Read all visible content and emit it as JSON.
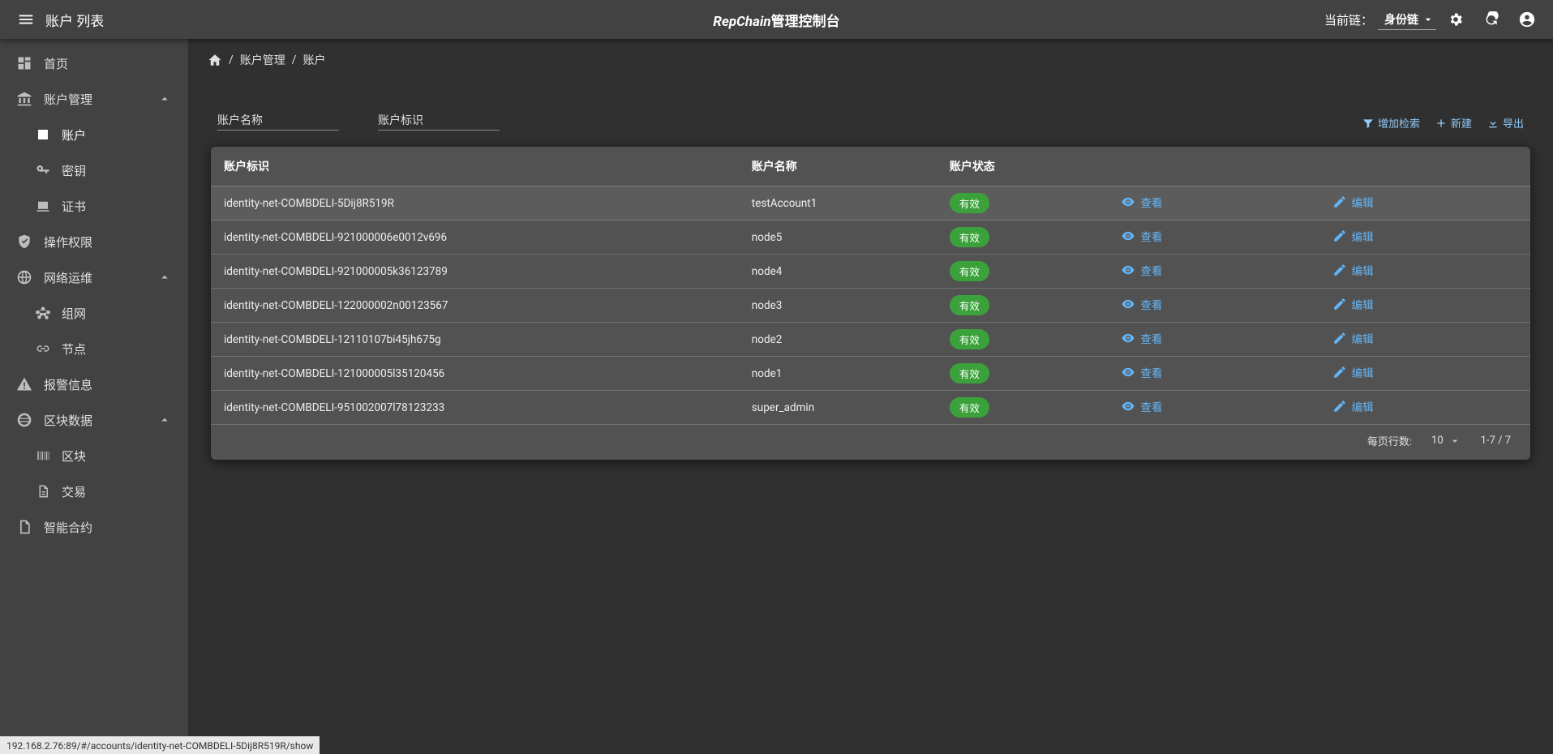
{
  "appbar": {
    "page_title": "账户 列表",
    "app_title_em": "RepChain",
    "app_title_rest": "管理控制台",
    "chain_label": "当前链：",
    "chain_value": "身份链"
  },
  "sidebar": {
    "home": "首页",
    "account_mgmt": "账户管理",
    "account": "账户",
    "key": "密钥",
    "cert": "证书",
    "op_perm": "操作权限",
    "net_ops": "网络运维",
    "network": "组网",
    "node": "节点",
    "alarm": "报警信息",
    "block_data": "区块数据",
    "block": "区块",
    "tx": "交易",
    "contract": "智能合约"
  },
  "breadcrumb": {
    "b1": "账户管理",
    "b2": "账户"
  },
  "filters": {
    "name_label": "账户名称",
    "id_label": "账户标识"
  },
  "toolbar": {
    "add_filter": "增加检索",
    "create": "新建",
    "export": "导出"
  },
  "table": {
    "col_id": "账户标识",
    "col_name": "账户名称",
    "col_status": "账户状态",
    "view": "查看",
    "edit": "编辑",
    "rows": [
      {
        "id": "identity-net-COMBDELI-5Dij8R519R",
        "name": "testAccount1",
        "status": "有效"
      },
      {
        "id": "identity-net-COMBDELI-921000006e0012v696",
        "name": "node5",
        "status": "有效"
      },
      {
        "id": "identity-net-COMBDELI-921000005k36123789",
        "name": "node4",
        "status": "有效"
      },
      {
        "id": "identity-net-COMBDELI-122000002n00123567",
        "name": "node3",
        "status": "有效"
      },
      {
        "id": "identity-net-COMBDELI-12110107bi45jh675g",
        "name": "node2",
        "status": "有效"
      },
      {
        "id": "identity-net-COMBDELI-121000005l35120456",
        "name": "node1",
        "status": "有效"
      },
      {
        "id": "identity-net-COMBDELI-951002007l78123233",
        "name": "super_admin",
        "status": "有效"
      }
    ]
  },
  "pagination": {
    "rows_per_page_label": "每页行数:",
    "rows_per_page": "10",
    "range": "1-7 / 7"
  },
  "statusbar": {
    "url": "192.168.2.76:89/#/accounts/identity-net-COMBDELI-5Dij8R519R/show"
  }
}
